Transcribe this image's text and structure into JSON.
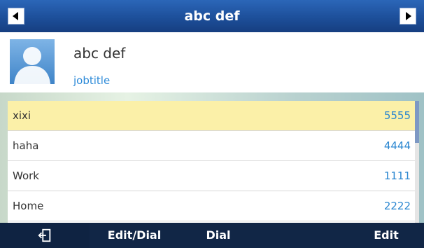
{
  "header": {
    "title": "abc def"
  },
  "contact": {
    "name": "abc def",
    "job_title": "jobtitle"
  },
  "numbers": [
    {
      "label": "xixi",
      "number": "5555",
      "selected": true
    },
    {
      "label": "haha",
      "number": "4444",
      "selected": false
    },
    {
      "label": "Work",
      "number": "1111",
      "selected": false
    },
    {
      "label": "Home",
      "number": "2222",
      "selected": false
    }
  ],
  "softkeys": {
    "back_icon": "exit-icon",
    "edit_dial": "Edit/Dial",
    "dial": "Dial",
    "edit": "Edit"
  },
  "colors": {
    "selection": "#fbf0a8",
    "number_text": "#2a86d0",
    "title_bar": "#1d4f9a"
  }
}
